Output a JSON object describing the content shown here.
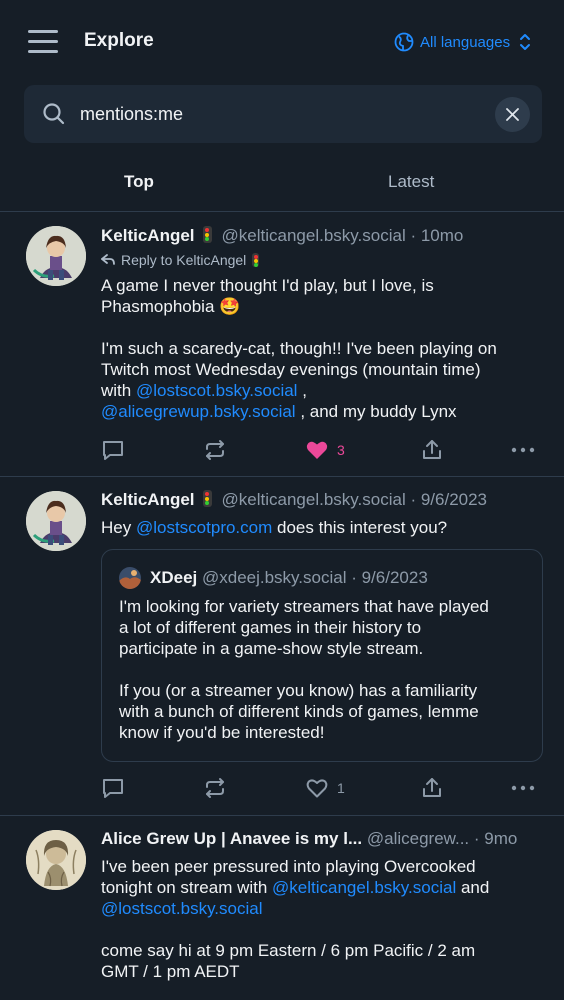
{
  "header": {
    "title": "Explore",
    "language_label": "All languages"
  },
  "search": {
    "value": "mentions:me",
    "placeholder": "Search"
  },
  "tabs": [
    {
      "label": "Top",
      "active": true
    },
    {
      "label": "Latest",
      "active": false
    }
  ],
  "posts": [
    {
      "author": "KelticAngel",
      "handle": "@kelticangel.bsky.social",
      "time": "· 10mo",
      "reply_to_label": "Reply to KelticAngel",
      "text_1": "A game I never thought I'd play, but I love, is",
      "text_2": "Phasmophobia 🤩",
      "text_3": "I'm such a scaredy-cat, though!! I've been playing on",
      "text_4": "Twitch most Wednesday evenings (mountain time)",
      "text_5_prefix": "with ",
      "mention_1": "@lostscot.bsky.social",
      "text_5_suffix": " ,",
      "mention_2": "@alicegrewup.bsky.social",
      "text_6_suffix": " , and my buddy Lynx",
      "like_count": "3",
      "liked": true
    },
    {
      "author": "KelticAngel",
      "handle": "@kelticangel.bsky.social",
      "time": "· 9/6/2023",
      "text_prefix": "Hey ",
      "mention": "@lostscotpro.com",
      "text_suffix": " does this interest you?",
      "quote": {
        "author": "XDeej",
        "handle": "@xdeej.bsky.social",
        "time": "· 9/6/2023",
        "text_1": "I'm looking for variety streamers that have played",
        "text_2": "a lot of different games in their history to",
        "text_3": "participate in a game-show style stream.",
        "text_4": "If you (or a streamer you know) has a familiarity",
        "text_5": "with a bunch of different kinds of games, lemme",
        "text_6": "know if you'd be interested!"
      },
      "like_count": "1",
      "liked": false
    },
    {
      "author": "Alice Grew Up | Anavee is my l...",
      "handle": "@alicegrew...",
      "time": "· 9mo",
      "text_1": "I've been peer pressured into playing Overcooked",
      "text_2_prefix": "tonight on stream with ",
      "mention_1": "@kelticangel.bsky.social",
      "text_2_suffix": " and",
      "mention_2": "@lostscot.bsky.social",
      "text_3": "come say hi at 9 pm Eastern / 6 pm Pacific / 2 am",
      "text_4": "GMT / 1 pm AEDT"
    }
  ],
  "colors": {
    "background": "#161e27",
    "accent": "#208bfe",
    "like": "#ec4899",
    "muted": "#8d9aa8"
  }
}
